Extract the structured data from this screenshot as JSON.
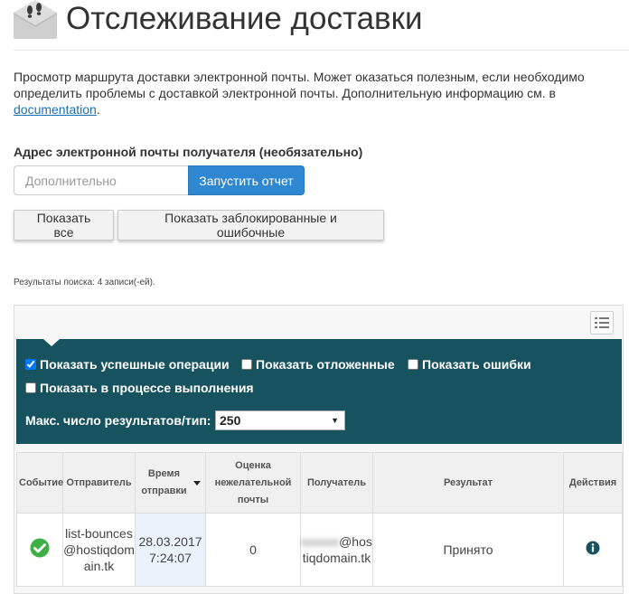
{
  "header": {
    "title": "Отслеживание доставки",
    "icon": "footprints-envelope-icon"
  },
  "description": {
    "text": "Просмотр маршрута доставки электронной почты. Может оказаться полезным, если необходимо определить проблемы с доставкой электронной почты. Дополнительную информацию см. в ",
    "link": "documentation",
    "suffix": "."
  },
  "recipient": {
    "label": "Адрес электронной почты получателя (необязательно)",
    "placeholder": "Дополнительно",
    "run_button": "Запустить отчет"
  },
  "buttons": {
    "show_all": "Показать все",
    "show_blocked": "Показать заблокированные и ошибочные"
  },
  "results_count": "Результаты поиска: 4 записи(-ей).",
  "filters": {
    "show_success": "Показать успешные операции",
    "show_deferred": "Показать отложенные",
    "show_errors": "Показать ошибки",
    "show_in_progress": "Показать в процессе выполнения",
    "max_label": "Макс. число результатов/тип:",
    "max_value": "250"
  },
  "table": {
    "headers": {
      "event": "Событие",
      "sender": "Отправитель",
      "sent_time": "Время отправки",
      "spam_score": "Оценка нежелательной почты",
      "recipient": "Получатель",
      "result": "Результат",
      "actions": "Действия"
    },
    "rows": [
      {
        "sender": "list-bounces@hostiqdomain.tk",
        "sent_time": "28.03.2017 7:24:07",
        "spam_score": "0",
        "recipient_domain": "@hostiqdomain.tk",
        "result": "Принято"
      }
    ]
  },
  "colors": {
    "accent": "#2f86d1",
    "filter_bg": "#17535f",
    "success": "#3cb045"
  }
}
